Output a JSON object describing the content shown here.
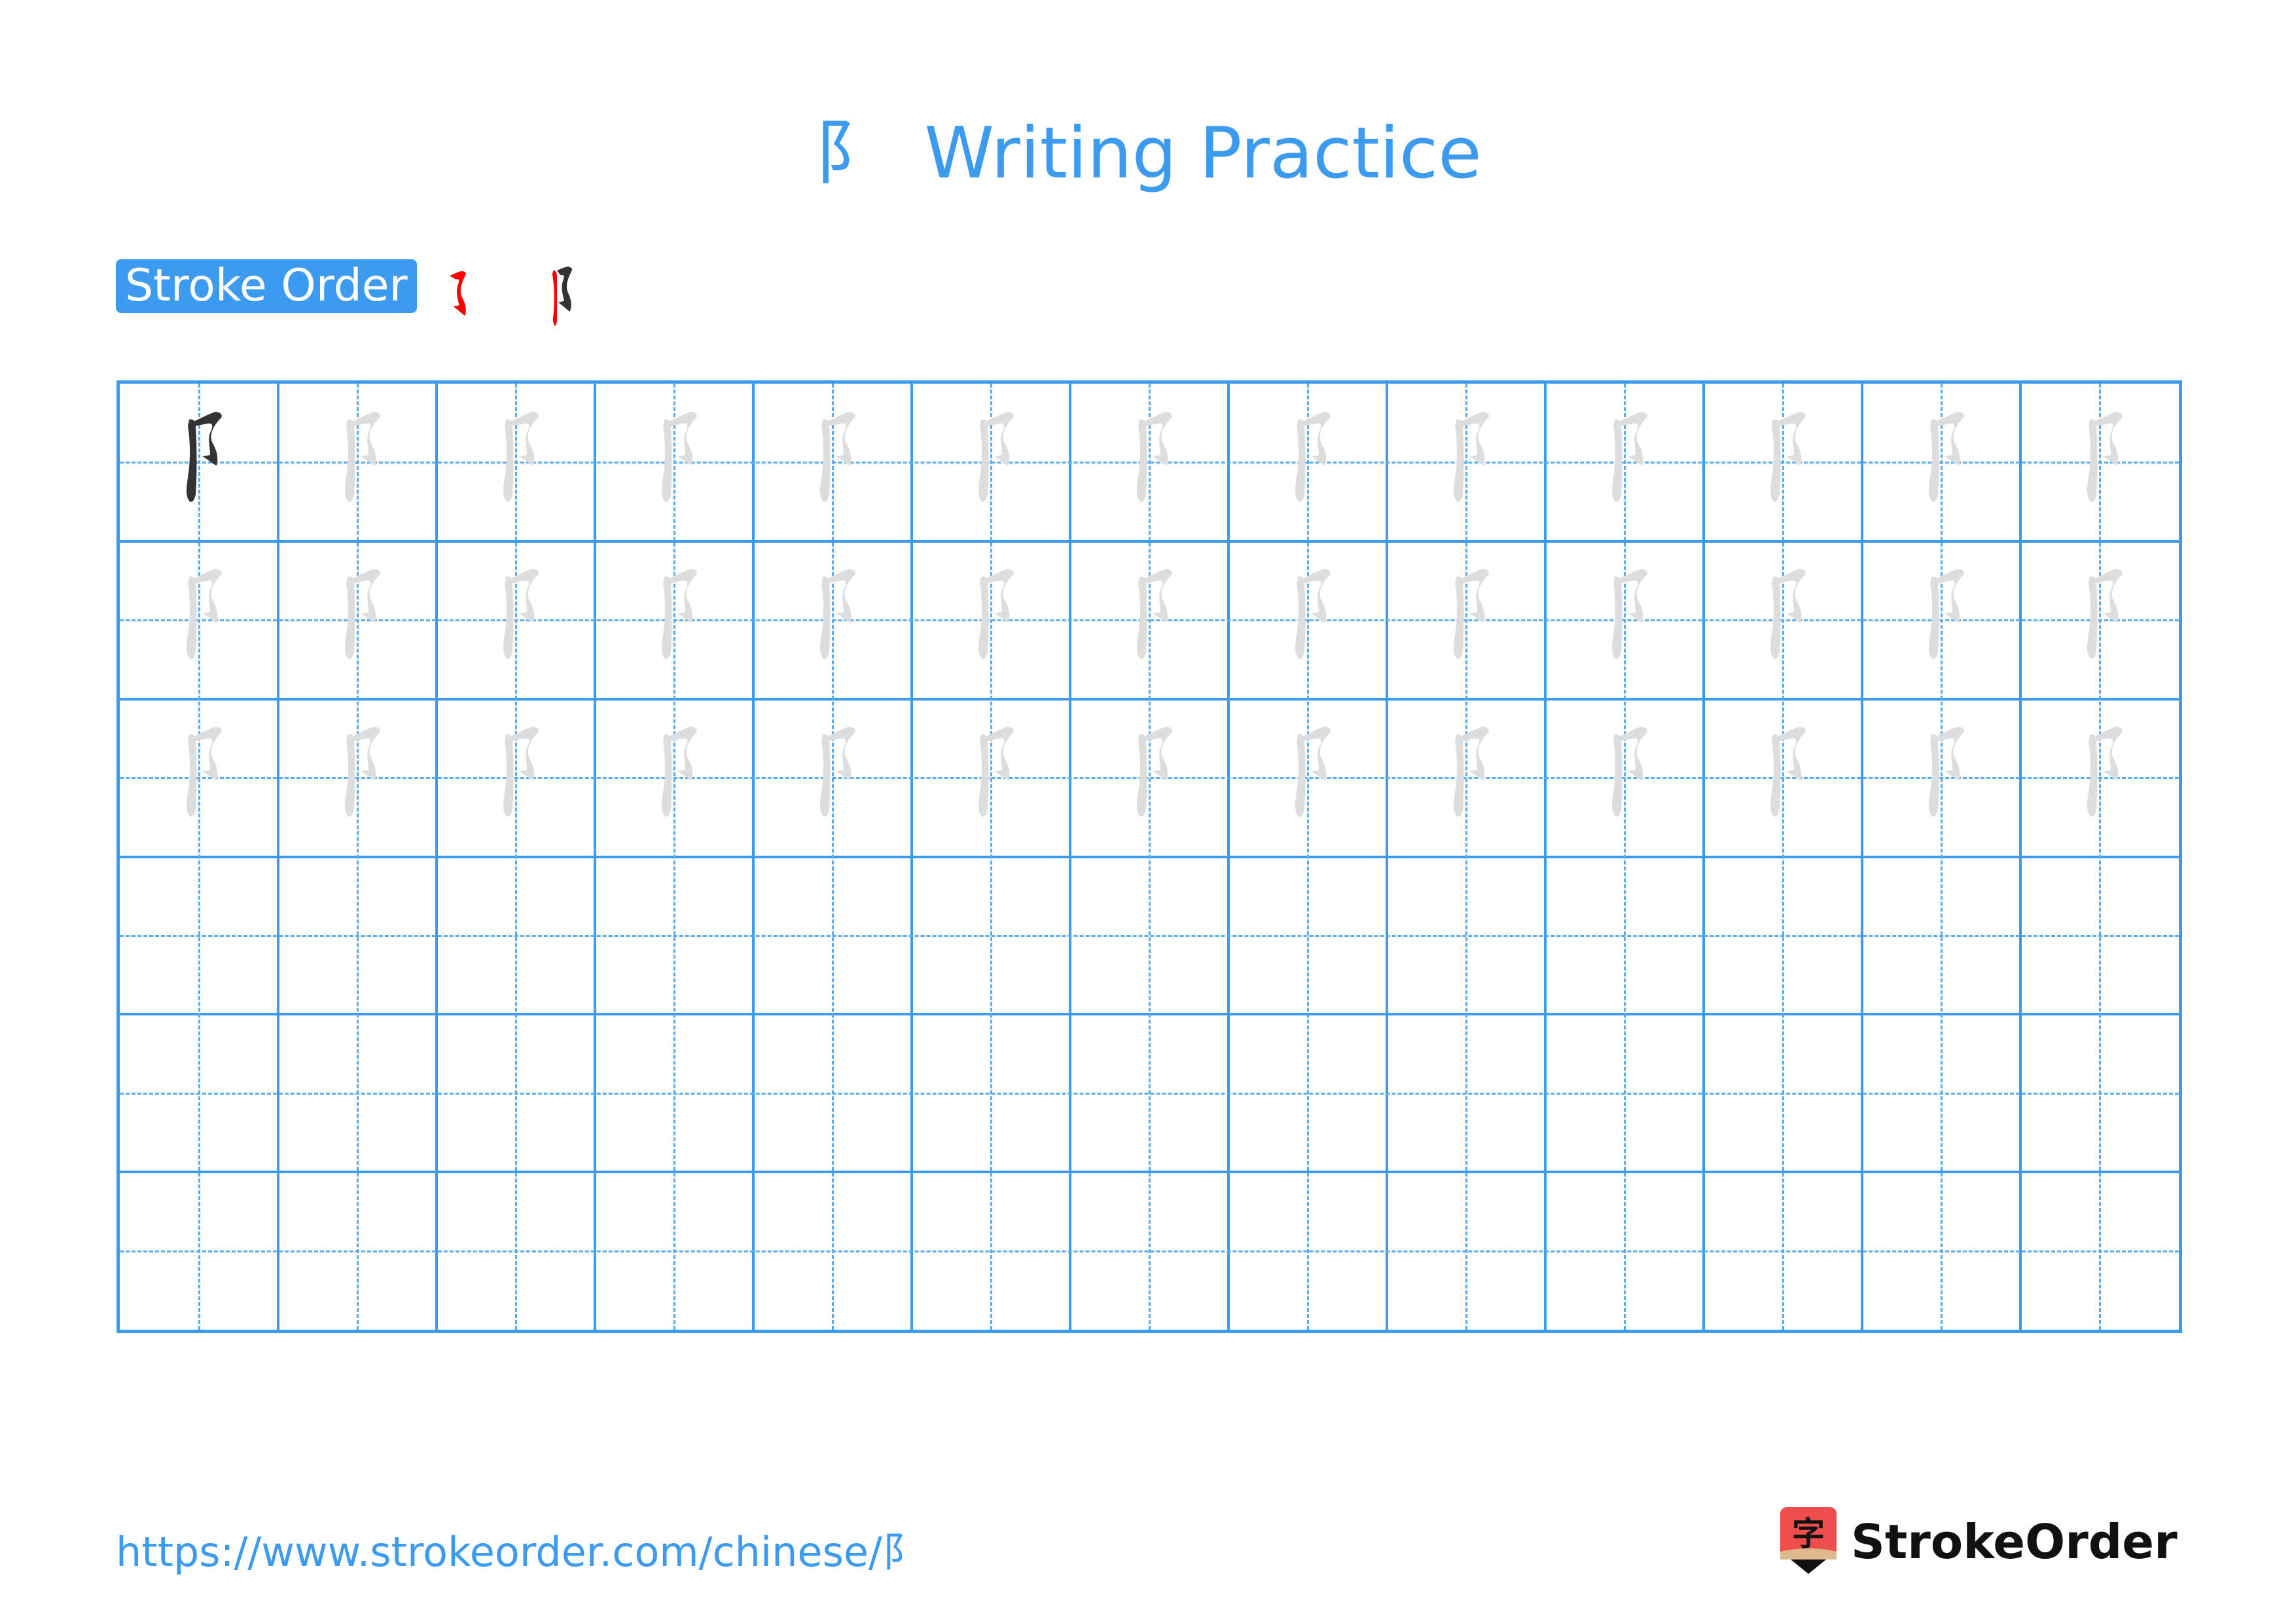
{
  "page": {
    "character": "阝",
    "title_suffix": "Writing Practice",
    "stroke_order_label": "Stroke Order",
    "stroke_count": 2,
    "url": "https://www.strokeorder.com/chinese/阝",
    "brand_name": "StrokeOrder",
    "brand_logo_char": "字"
  },
  "grid": {
    "columns": 13,
    "rows": 6,
    "model_cells": 1,
    "trace_rows": 3,
    "empty_rows": 3
  },
  "colors": {
    "accent": "#3d9bef",
    "stroke_active": "#ff0000",
    "stroke_done": "#333333",
    "trace": "#dddddd",
    "logo_red": "#f04e4e",
    "logo_tan": "#ddb98e"
  }
}
